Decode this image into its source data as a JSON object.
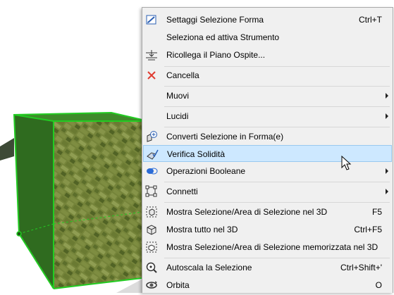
{
  "menu": {
    "items": [
      {
        "label": "Settaggi Selezione Forma",
        "shortcut": "Ctrl+T",
        "icon": "selection-settings-icon"
      },
      {
        "label": "Seleziona ed attiva Strumento",
        "shortcut": "",
        "icon": ""
      },
      {
        "label": "Ricollega il Piano Ospite...",
        "shortcut": "",
        "icon": "relink-host-floor-icon"
      },
      {
        "label": "Cancella",
        "shortcut": "",
        "icon": "delete-x-icon"
      },
      {
        "label": "Muovi",
        "shortcut": "",
        "icon": "",
        "submenu": true
      },
      {
        "label": "Lucidi",
        "shortcut": "",
        "icon": "",
        "submenu": true
      },
      {
        "label": "Converti Selezione in Forma(e)",
        "shortcut": "",
        "icon": "convert-to-morph-icon"
      },
      {
        "label": "Verifica Solidità",
        "shortcut": "",
        "icon": "check-solidity-icon",
        "highlighted": true
      },
      {
        "label": "Operazioni Booleane",
        "shortcut": "",
        "icon": "boolean-operations-icon",
        "submenu": true
      },
      {
        "label": "Connetti",
        "shortcut": "",
        "icon": "connect-icon",
        "submenu": true
      },
      {
        "label": "Mostra Selezione/Area di Selezione nel 3D",
        "shortcut": "F5",
        "icon": "show-selection-3d-icon"
      },
      {
        "label": "Mostra tutto nel 3D",
        "shortcut": "Ctrl+F5",
        "icon": "show-all-3d-icon"
      },
      {
        "label": "Mostra Selezione/Area di Selezione memorizzata nel 3D",
        "shortcut": "",
        "icon": "show-stored-selection-3d-icon"
      },
      {
        "label": "Autoscala la Selezione",
        "shortcut": "Ctrl+Shift+'",
        "icon": "zoom-to-selection-icon"
      },
      {
        "label": "Orbita",
        "shortcut": "O",
        "icon": "orbit-icon"
      }
    ]
  },
  "colors": {
    "menu_bg": "#f0f0f0",
    "highlight_bg": "#cde8ff",
    "highlight_border": "#99c9ef",
    "selection_outline": "#22cc22",
    "cube_side": "#2f6b1f",
    "cube_top": "#3f8a2a",
    "cube_texture": "#8f8a45",
    "delete_icon": "#e03c31",
    "boolean_icon": "#2a6bd6"
  }
}
